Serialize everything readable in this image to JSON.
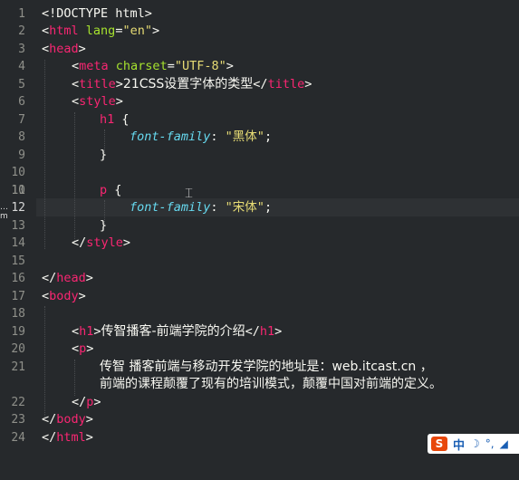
{
  "editor": {
    "line_numbers": [
      "1",
      "2",
      "3",
      "4",
      "5",
      "6",
      "7",
      "8",
      "9",
      "10",
      "11",
      "12",
      "13",
      "14",
      "15",
      "16",
      "17",
      "18",
      "19",
      "20",
      "21",
      "",
      "22",
      "23",
      "24"
    ],
    "current_line_number": "12",
    "cursor_marker": "…m",
    "code": {
      "l1": "<!DOCTYPE html>",
      "l2_tag": "html",
      "l2_attr": "lang",
      "l2_val": "\"en\"",
      "l3_tag": "head",
      "l4_tag": "meta",
      "l4_attr": "charset",
      "l4_val": "\"UTF-8\"",
      "l5_tag": "title",
      "l5_text": "21CSS设置字体的类型",
      "l6_tag": "style",
      "l7_sel": "h1",
      "l8_prop": "font-family",
      "l8_val": "\"黑体\"",
      "l11_sel": "p",
      "l12_prop": "font-family",
      "l12_val": "\"宋体\"",
      "l14_tag": "style",
      "l16_tag": "head",
      "l17_tag": "body",
      "l19_tag": "h1",
      "l19_text": "传智播客-前端学院的介绍",
      "l20_tag": "p",
      "l21_text": "传智 播客前端与移动开发学院的地址是：web.itcast.cn ，",
      "l21b_text": "前端的课程颠覆了现有的培训模式，颠覆中国对前端的定义。",
      "l22_tag": "p",
      "l23_tag": "body",
      "l24_tag": "html"
    }
  },
  "ime": {
    "logo": "S",
    "mode": "中",
    "moon_icon": "☽",
    "punct_icon": "°,",
    "skin_icon": "◢"
  },
  "colors": {
    "background": "#26292c",
    "tag": "#f92672",
    "attribute": "#a6e22e",
    "string": "#e6db74",
    "property": "#66d9ef"
  }
}
